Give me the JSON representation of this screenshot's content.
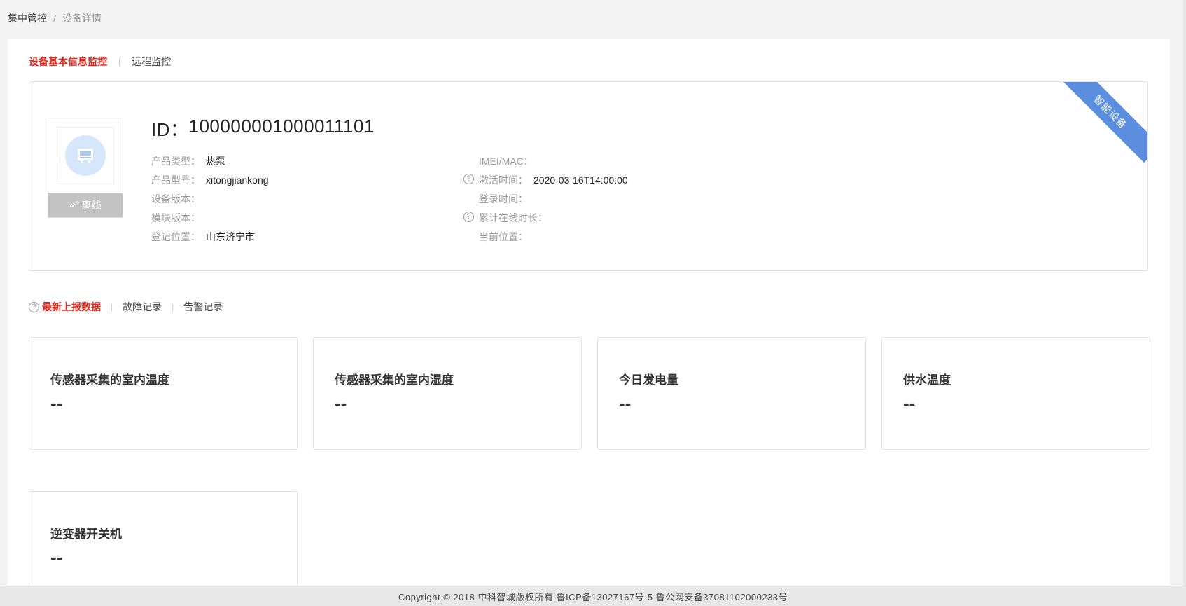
{
  "breadcrumb": {
    "root": "集中管控",
    "separator": "/",
    "current": "设备详情"
  },
  "top_tabs": [
    {
      "label": "设备基本信息监控",
      "active": true
    },
    {
      "label": "远程监控",
      "active": false
    }
  ],
  "device": {
    "ribbon": "智能设备",
    "status": "离线",
    "id_label": "ID：",
    "id_value": "100000001000011101",
    "left_info": [
      {
        "label": "产品类型：",
        "value": "热泵"
      },
      {
        "label": "产品型号：",
        "value": "xitongjiankong"
      },
      {
        "label": "设备版本：",
        "value": ""
      },
      {
        "label": "模块版本：",
        "value": ""
      },
      {
        "label": "登记位置：",
        "value": "山东济宁市"
      }
    ],
    "right_info": [
      {
        "label": "IMEI/MAC：",
        "value": "",
        "help": false
      },
      {
        "label": "激活时间：",
        "value": "2020-03-16T14:00:00",
        "help": true
      },
      {
        "label": "登录时间：",
        "value": "",
        "help": false
      },
      {
        "label": "累计在线时长：",
        "value": "",
        "help": true
      },
      {
        "label": "当前位置：",
        "value": "",
        "help": false
      }
    ]
  },
  "data_tabs": [
    {
      "label": "最新上报数据",
      "active": true
    },
    {
      "label": "故障记录",
      "active": false
    },
    {
      "label": "告警记录",
      "active": false
    }
  ],
  "metrics": [
    {
      "title": "传感器采集的室内温度",
      "value": "--"
    },
    {
      "title": "传感器采集的室内湿度",
      "value": "--"
    },
    {
      "title": "今日发电量",
      "value": "--"
    },
    {
      "title": "供水温度",
      "value": "--"
    },
    {
      "title": "逆变器开关机",
      "value": "--"
    }
  ],
  "footer": {
    "copyright": "Copyright © 2018 中科智城版权所有 鲁ICP备13027167号-5 鲁公网安备37081102000233号"
  },
  "colors": {
    "accent_red": "#e0261a",
    "ribbon_blue": "#5b8ede",
    "offline_gray": "#c3c3c3"
  }
}
